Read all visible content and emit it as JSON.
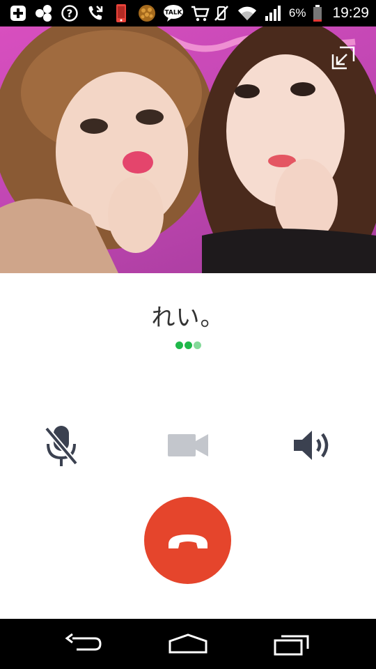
{
  "status_bar": {
    "battery_percent": "6%",
    "time": "19:29",
    "talk_badge": "TALK",
    "icons": [
      "add-box-icon",
      "hexagons-icon",
      "help-circle-icon",
      "missed-call-icon",
      "phone-device-icon",
      "brain-app-icon",
      "talk-bubble-icon",
      "shopping-cart-icon",
      "vibrate-off-icon",
      "wifi-icon",
      "signal-icon",
      "battery-icon"
    ]
  },
  "call": {
    "caller_name": "れい。",
    "status_dots": 3
  },
  "controls": {
    "mute": "mic-off-icon",
    "video": "video-camera-icon",
    "speaker": "speaker-icon",
    "end_call": "hang-up-icon"
  },
  "colors": {
    "end_call": "#e5452c",
    "dots_active": "#1fb84a",
    "dots_light": "#85d99a",
    "control_dark": "#3b4150",
    "control_disabled": "#c3c6cc",
    "photo_bg": "#c247b4"
  },
  "nav_bar": {
    "icons": [
      "back-icon",
      "home-icon",
      "recents-icon"
    ]
  }
}
